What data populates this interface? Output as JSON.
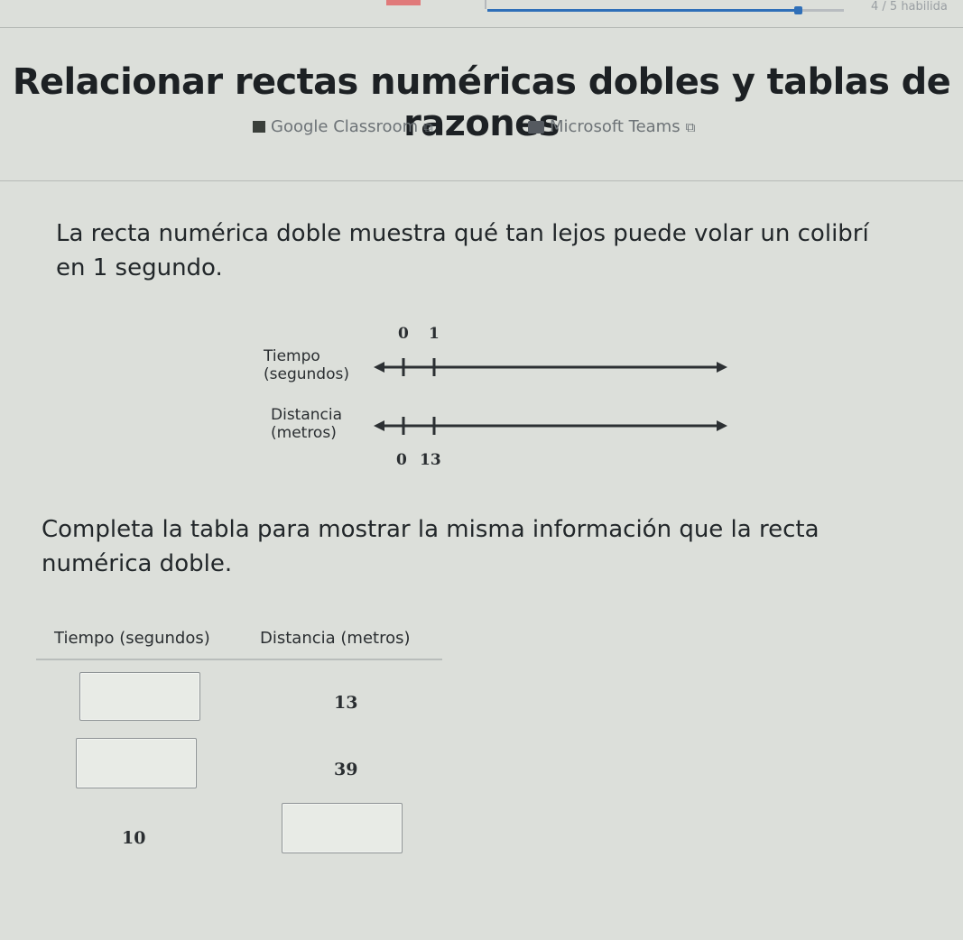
{
  "header": {
    "skill_progress_text": "4 / 5 habilida",
    "progress_fraction": 0.87
  },
  "title": "Relacionar rectas numéricas dobles y tablas de razones",
  "share": {
    "google_classroom": "Google Classroom",
    "microsoft_teams": "Microsoft Teams"
  },
  "prompt": "La recta numérica doble muestra qué tan lejos puede volar un colibrí en 1 segundo.",
  "double_number_line": {
    "top_label_line1": "Tiempo",
    "top_label_line2": "(segundos)",
    "bottom_label_line1": "Distancia",
    "bottom_label_line2": "(metros)",
    "top_values": [
      "0",
      "1"
    ],
    "bottom_values": [
      "0",
      "13"
    ]
  },
  "instruction": "Completa la tabla para mostrar la misma información que la recta numérica doble.",
  "table": {
    "col_time": "Tiempo (segundos)",
    "col_distance": "Distancia (metros)",
    "rows": [
      {
        "time": "",
        "distance": "13"
      },
      {
        "time": "",
        "distance": "39"
      },
      {
        "time": "10",
        "distance": ""
      }
    ]
  },
  "colors": {
    "background": "#dcdfda",
    "text": "#1f2326",
    "progress": "#2f6fb8"
  }
}
